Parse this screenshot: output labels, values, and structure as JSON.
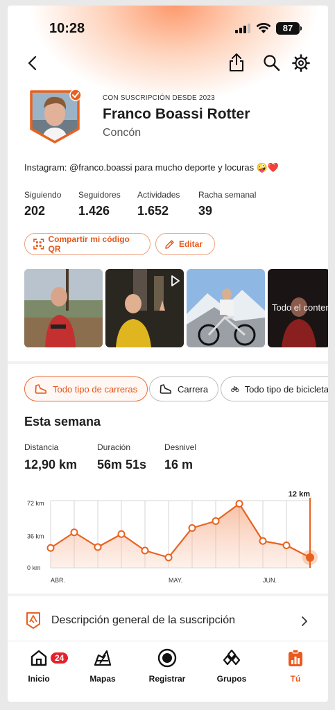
{
  "status_bar": {
    "time": "10:28",
    "battery": "87"
  },
  "profile": {
    "subscription_label": "CON SUSCRIPCIÓN DESDE 2023",
    "name": "Franco Boassi Rotter",
    "city": "Concón",
    "bio": "Instagram: @franco.boassi para mucho deporte y locuras 🤪❤️"
  },
  "stats": [
    {
      "label": "Siguiendo",
      "value": "202"
    },
    {
      "label": "Seguidores",
      "value": "1.426"
    },
    {
      "label": "Actividades",
      "value": "1.652"
    },
    {
      "label": "Racha semanal",
      "value": "39"
    }
  ],
  "actions": {
    "share_qr": "Compartir mi código QR",
    "edit": "Editar"
  },
  "photos": {
    "overlay_text": "Todo el conten"
  },
  "filters": [
    {
      "label": "Todo tipo de carreras",
      "active": true
    },
    {
      "label": "Carrera",
      "active": false
    },
    {
      "label": "Todo tipo de bicicleta",
      "active": false
    }
  ],
  "week": {
    "title": "Esta semana",
    "stats": [
      {
        "label": "Distancia",
        "value": "12,90 km"
      },
      {
        "label": "Duración",
        "value": "56m 51s"
      },
      {
        "label": "Desnivel",
        "value": "16 m"
      }
    ]
  },
  "chart_data": {
    "type": "area",
    "current_label": "12 km",
    "y_ticks": [
      "72 km",
      "36 km",
      "0 km"
    ],
    "ylim": [
      0,
      80
    ],
    "x_labels": [
      "ABR.",
      "MAY.",
      "JUN."
    ],
    "values": [
      23,
      41,
      24,
      39,
      20,
      12,
      46,
      54,
      74,
      31,
      26,
      12
    ],
    "color": "#e8621f"
  },
  "subscription_row": {
    "label": "Descripción general de la suscripción"
  },
  "tabbar": {
    "items": [
      {
        "label": "Inicio",
        "icon": "home-icon",
        "badge": "24"
      },
      {
        "label": "Mapas",
        "icon": "map-icon"
      },
      {
        "label": "Registrar",
        "icon": "record-icon"
      },
      {
        "label": "Grupos",
        "icon": "groups-icon"
      },
      {
        "label": "Tú",
        "icon": "you-icon"
      }
    ]
  },
  "colors": {
    "accent": "#e8621f",
    "badge": "#e5212c"
  }
}
